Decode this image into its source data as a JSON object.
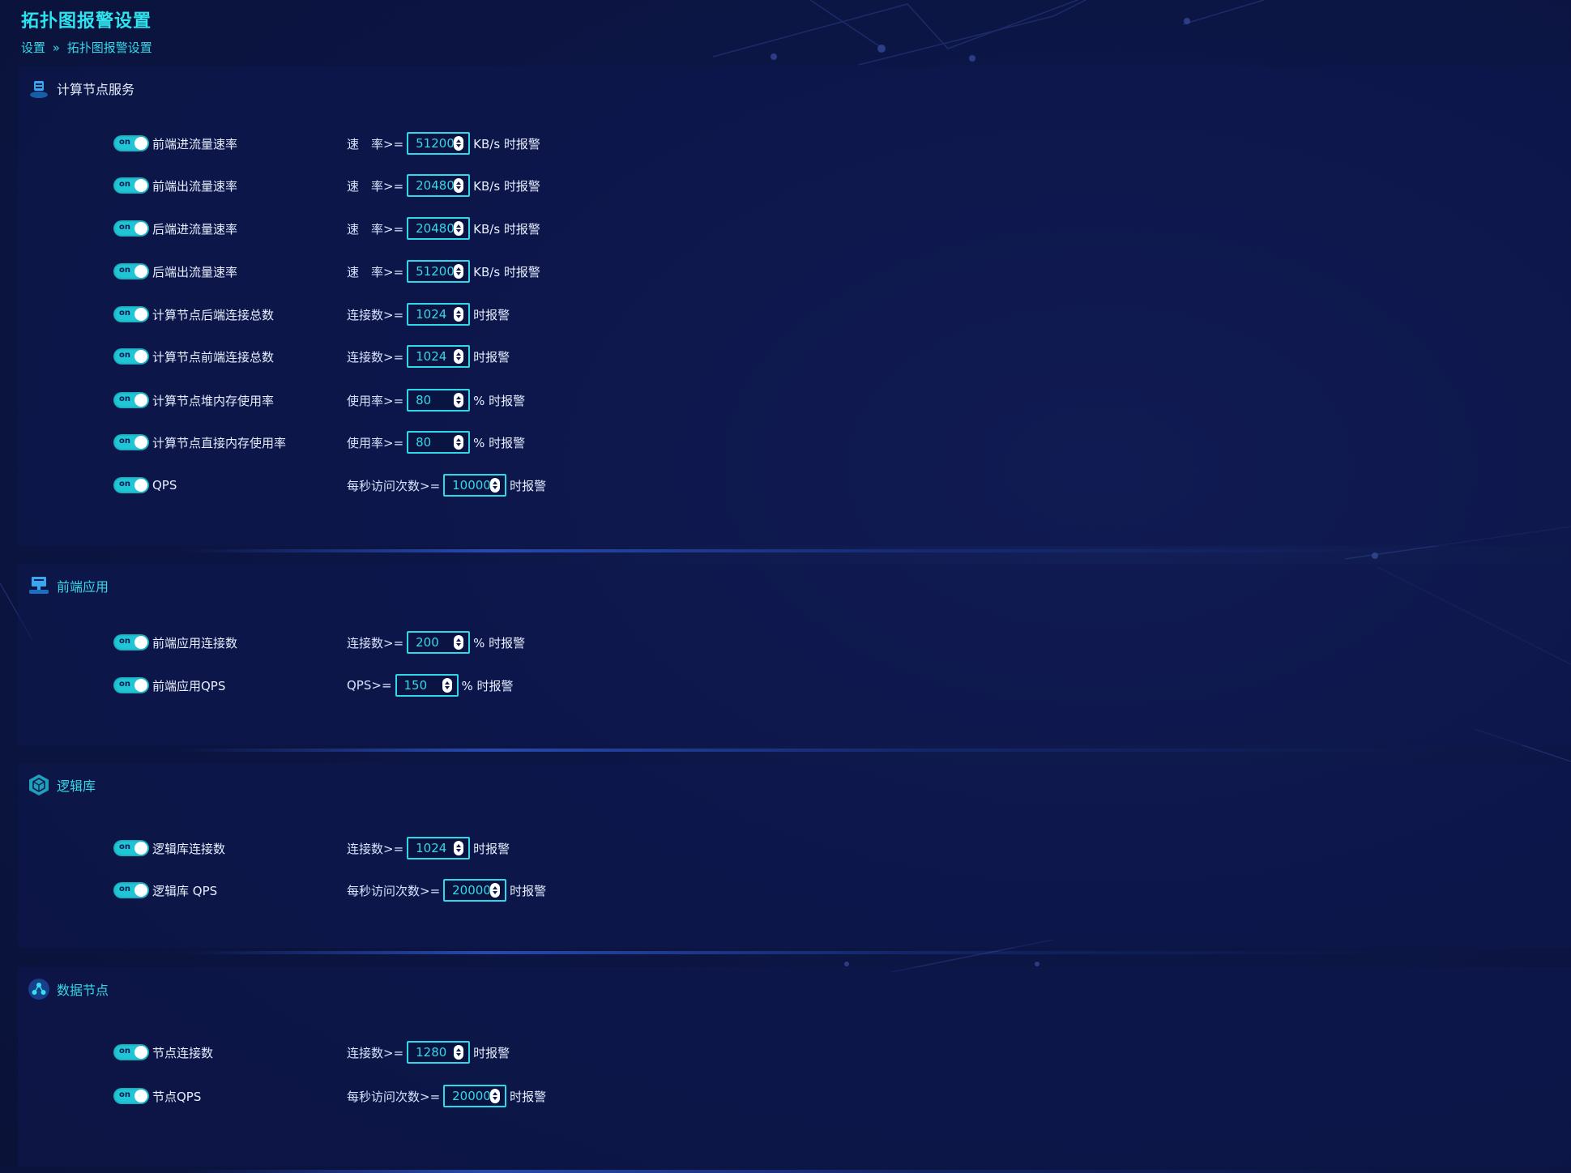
{
  "page": {
    "title": "拓扑图报警设置",
    "breadcrumb": [
      "设置",
      "»",
      "拓扑图报警设置"
    ]
  },
  "toggle_text": "on",
  "sections": [
    {
      "title": "计算节点服务",
      "icon": "server-icon",
      "rows": [
        {
          "label": "前端进流量速率",
          "condition": "速　率>=",
          "value": "51200",
          "suffix": "KB/s 时报警"
        },
        {
          "label": "前端出流量速率",
          "condition": "速　率>=",
          "value": "20480",
          "suffix": "KB/s 时报警"
        },
        {
          "label": "后端进流量速率",
          "condition": "速　率>=",
          "value": "20480",
          "suffix": "KB/s 时报警"
        },
        {
          "label": "后端出流量速率",
          "condition": "速　率>=",
          "value": "51200",
          "suffix": "KB/s 时报警"
        },
        {
          "label": "计算节点后端连接总数",
          "condition": "连接数>=",
          "value": "1024",
          "suffix": "时报警"
        },
        {
          "label": "计算节点前端连接总数",
          "condition": "连接数>=",
          "value": "1024",
          "suffix": "时报警"
        },
        {
          "label": "计算节点堆内存使用率",
          "condition": "使用率>=",
          "value": "80",
          "suffix": "% 时报警"
        },
        {
          "label": "计算节点直接内存使用率",
          "condition": "使用率>=",
          "value": "80",
          "suffix": "% 时报警"
        },
        {
          "label": "QPS",
          "condition": "每秒访问次数>=",
          "value": "10000",
          "suffix": "时报警"
        }
      ]
    },
    {
      "title": "前端应用",
      "icon": "monitor-icon",
      "rows": [
        {
          "label": "前端应用连接数",
          "condition": "连接数>=",
          "value": "200",
          "suffix": "% 时报警"
        },
        {
          "label": "前端应用QPS",
          "condition": "QPS>=",
          "value": "150",
          "suffix": "% 时报警"
        }
      ]
    },
    {
      "title": "逻辑库",
      "icon": "database-cube-icon",
      "rows": [
        {
          "label": "逻辑库连接数",
          "condition": "连接数>=",
          "value": "1024",
          "suffix": "时报警"
        },
        {
          "label": "逻辑库 QPS",
          "condition": "每秒访问次数>=",
          "value": "20000",
          "suffix": "时报警"
        }
      ]
    },
    {
      "title": "数据节点",
      "icon": "node-network-icon",
      "rows": [
        {
          "label": "节点连接数",
          "condition": "连接数>=",
          "value": "1280",
          "suffix": "时报警"
        },
        {
          "label": "节点QPS",
          "condition": "每秒访问次数>=",
          "value": "20000",
          "suffix": "时报警"
        }
      ]
    }
  ],
  "colors": {
    "accent": "#2fe3ee",
    "toggle_on": "#20c6d6",
    "background": "#0c1645"
  }
}
